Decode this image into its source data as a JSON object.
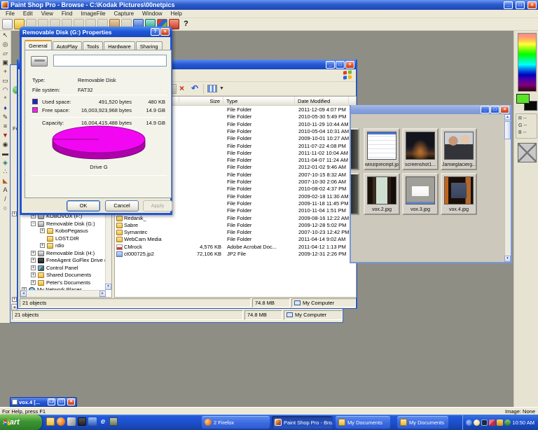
{
  "app": {
    "title": "Paint Shop Pro - Browse - C:\\Kodak Pictures\\00netpics",
    "menus": [
      "File",
      "Edit",
      "View",
      "Find",
      "ImageFile",
      "Capture",
      "Window",
      "Help"
    ],
    "toolbar_icons": [
      "new-file",
      "open-file",
      "save-file",
      "print",
      "cut",
      "copy",
      "paste",
      "undo",
      "redo",
      "browse",
      "full-screen",
      "dual-view",
      "zoom-normal",
      "color-palette",
      "screen-capture",
      "context-help"
    ],
    "tool_palette": [
      "arrow",
      "zoom",
      "deformation",
      "crop",
      "mover",
      "selection",
      "freehand-selection",
      "magic-wand",
      "dropper",
      "paintbrush",
      "clone-brush",
      "color-replacer",
      "retouch",
      "eraser",
      "picture-tube",
      "airbrush",
      "flood-fill",
      "text",
      "draw",
      "preset-shapes"
    ],
    "status_left": "For Help, press F1",
    "status_right": "Image: None"
  },
  "color_panel": {
    "r_label": "R --",
    "g_label": "G --",
    "b_label": "B --",
    "foreground": "#5ae428",
    "background": "#0a0a0a"
  },
  "dialog": {
    "title": "Removable Disk (G:) Properties",
    "tabs": [
      "General",
      "AutoPlay",
      "Tools",
      "Hardware",
      "Sharing"
    ],
    "active_tab": "General",
    "label_value": "",
    "type_label": "Type:",
    "type_value": "Removable Disk",
    "fs_label": "File system:",
    "fs_value": "FAT32",
    "used_label": "Used space:",
    "used_bytes": "491,520 bytes",
    "used_size": "480 KB",
    "used_color": "#2222cc",
    "free_label": "Free space:",
    "free_bytes": "16,003,923,968 bytes",
    "free_size": "14.9 GB",
    "free_color": "#ee22ee",
    "capacity_label": "Capacity:",
    "capacity_bytes": "16,004,415,488 bytes",
    "capacity_size": "14.9 GB",
    "drive_label": "Drive G",
    "ok_label": "OK",
    "cancel_label": "Cancel",
    "apply_label": "Apply"
  },
  "explorer": {
    "columns": [
      "Name",
      "Size",
      "Type",
      "Date Modified"
    ],
    "toolbar_icons": [
      "delete",
      "undo",
      "views"
    ],
    "rows": [
      {
        "name": "",
        "size": "",
        "type": "File Folder",
        "date": "2011-12-09 4:07 PM",
        "icon": ""
      },
      {
        "name": "",
        "size": "",
        "type": "File Folder",
        "date": "2010-05-30 5:49 PM",
        "icon": ""
      },
      {
        "name": "",
        "size": "",
        "type": "File Folder",
        "date": "2010-11-29 10:44 AM",
        "icon": ""
      },
      {
        "name": "",
        "size": "",
        "type": "File Folder",
        "date": "2010-05-04 10:31 AM",
        "icon": ""
      },
      {
        "name": "",
        "size": "",
        "type": "File Folder",
        "date": "2009-10-01 10:27 AM",
        "icon": ""
      },
      {
        "name": "",
        "size": "",
        "type": "File Folder",
        "date": "2011-07-22 4:08 PM",
        "icon": ""
      },
      {
        "name": "",
        "size": "",
        "type": "File Folder",
        "date": "2011-11-02 10:04 AM",
        "icon": ""
      },
      {
        "name": "",
        "size": "",
        "type": "File Folder",
        "date": "2011-04-07 11:24 AM",
        "icon": ""
      },
      {
        "name": "",
        "size": "",
        "type": "File Folder",
        "date": "2012-01-02 9:46 AM",
        "icon": ""
      },
      {
        "name": "",
        "size": "",
        "type": "File Folder",
        "date": "2007-10-15 8:32 AM",
        "icon": ""
      },
      {
        "name": "",
        "size": "",
        "type": "File Folder",
        "date": "2007-10-30 2:06 AM",
        "icon": ""
      },
      {
        "name": "",
        "size": "",
        "type": "File Folder",
        "date": "2010-08-02 4:37 PM",
        "icon": ""
      },
      {
        "name": "",
        "size": "",
        "type": "File Folder",
        "date": "2009-02-18 11:30 AM",
        "icon": ""
      },
      {
        "name": "",
        "size": "",
        "type": "File Folder",
        "date": "2009-11-18 11:45 PM",
        "icon": ""
      },
      {
        "name": "",
        "size": "",
        "type": "File Folder",
        "date": "2010-11-04 1:51 PM",
        "icon": ""
      },
      {
        "name": "Redanik_",
        "size": "",
        "type": "File Folder",
        "date": "2009-08-16 12:22 AM",
        "icon": "folder"
      },
      {
        "name": "Sabre",
        "size": "",
        "type": "File Folder",
        "date": "2009-12-28 5:02 PM",
        "icon": "folder"
      },
      {
        "name": "Symantec",
        "size": "",
        "type": "File Folder",
        "date": "2007-10-23 12:42 PM",
        "icon": "folder"
      },
      {
        "name": "WebCam Media",
        "size": "",
        "type": "File Folder",
        "date": "2011-04-14 9:02 AM",
        "icon": "folder"
      },
      {
        "name": "CMrock",
        "size": "4,576 KB",
        "type": "Adobe Acrobat Doc...",
        "date": "2011-04-12 1:13 PM",
        "icon": "pdf"
      },
      {
        "name": "ct000725.jp2",
        "size": "72,106 KB",
        "type": "JP2 File",
        "date": "2009-12-31 2:26 PM",
        "icon": "image"
      }
    ],
    "tree": [
      {
        "label": "KOBOVOX (F:)",
        "level": 2,
        "exp": "+",
        "icon": "drive"
      },
      {
        "label": "Removable Disk (G:)",
        "level": 2,
        "exp": "-",
        "icon": "drive"
      },
      {
        "label": "KoboPegasus",
        "level": 3,
        "exp": "+",
        "icon": "folder"
      },
      {
        "label": "LOST.DIR",
        "level": 3,
        "exp": "",
        "icon": "folder"
      },
      {
        "label": "rdio",
        "level": 3,
        "exp": "+",
        "icon": "folder"
      },
      {
        "label": "Removable Disk (H:)",
        "level": 2,
        "exp": "+",
        "icon": "drive"
      },
      {
        "label": "FreeAgent GoFlex Drive (K:)",
        "level": 2,
        "exp": "+",
        "icon": "drive2"
      },
      {
        "label": "Control Panel",
        "level": 2,
        "exp": "+",
        "icon": "control"
      },
      {
        "label": "Shared Documents",
        "level": 2,
        "exp": "+",
        "icon": "folder"
      },
      {
        "label": "Peter's Documents",
        "level": 2,
        "exp": "+",
        "icon": "folder"
      },
      {
        "label": "My Network Places",
        "level": 1,
        "exp": "+",
        "icon": "network"
      }
    ],
    "status": {
      "objects": "21 objects",
      "size": "74.8 MB",
      "location": "My Computer"
    }
  },
  "outer_window": {
    "partial_text": "Fo"
  },
  "browser": {
    "thumbs": [
      {
        "label": "winzipreceipt.jpg"
      },
      {
        "label": "screenshot1..."
      },
      {
        "label": "Jamieglacierg..."
      },
      {
        "label": "vox.2.jpg"
      },
      {
        "label": "vox.3.jpg"
      },
      {
        "label": "vox.4.jpg"
      }
    ]
  },
  "minimized": {
    "title": "vox.4 [..."
  },
  "taskbar": {
    "start_label": "start",
    "quick_launch": [
      "my-documents",
      "firefox",
      "photo-app",
      "camera",
      "media-app",
      "internet-explorer",
      "security-app"
    ],
    "buttons": [
      {
        "label": "2 Firefox",
        "icon": "firefox",
        "active": false
      },
      {
        "label": "Paint Shop Pro - Bro...",
        "icon": "psp",
        "active": true
      },
      {
        "label": "My Documents",
        "icon": "folder",
        "active": false
      },
      {
        "label": "My Documents",
        "icon": "folder",
        "active": false
      }
    ],
    "tray_icons": [
      "language",
      "messenger",
      "display",
      "updates",
      "app",
      "antivirus"
    ],
    "clock": "10:50 AM"
  }
}
